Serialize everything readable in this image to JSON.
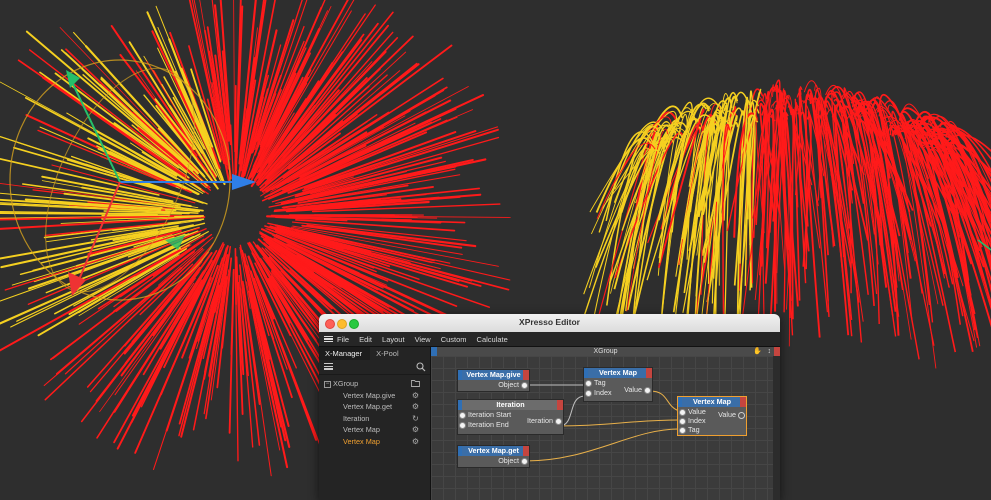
{
  "window": {
    "title": "XPresso Editor"
  },
  "menu": [
    "File",
    "Edit",
    "Layout",
    "View",
    "Custom",
    "Calculate"
  ],
  "tabs": {
    "manager": "X-Manager",
    "pool": "X-Pool"
  },
  "tree": [
    {
      "label": "XGroup",
      "icon": "folder-icon"
    },
    {
      "label": "Vertex Map.give",
      "icon": "gears-icon"
    },
    {
      "label": "Vertex Map.get",
      "icon": "gears-icon"
    },
    {
      "label": "Iteration",
      "icon": "loop-icon"
    },
    {
      "label": "Vertex Map",
      "icon": "gears-icon"
    },
    {
      "label": "Vertex Map",
      "icon": "gears-icon",
      "selected": true
    }
  ],
  "canvas": {
    "group_label": "XGroup"
  },
  "nodes": {
    "vm_give": {
      "title": "Vertex Map.give",
      "out": "Object"
    },
    "vm_node": {
      "title": "Vertex Map",
      "in1": "Tag",
      "in2": "Index",
      "out": "Value"
    },
    "iteration": {
      "title": "Iteration",
      "in1": "Iteration Start",
      "in2": "Iteration End",
      "out": "Iteration"
    },
    "vm_main": {
      "title": "Vertex Map",
      "in1": "Value",
      "in2": "Index",
      "in3": "Tag",
      "out": "Value"
    },
    "vm_get": {
      "title": "Vertex Map.get",
      "out": "Object"
    }
  },
  "colors": {
    "accent": "#f0a030",
    "node_header": "#3a6ea8",
    "wire": "#e8b04a",
    "hair_red": "#ff1a1a",
    "hair_yellow": "#f5d020"
  }
}
